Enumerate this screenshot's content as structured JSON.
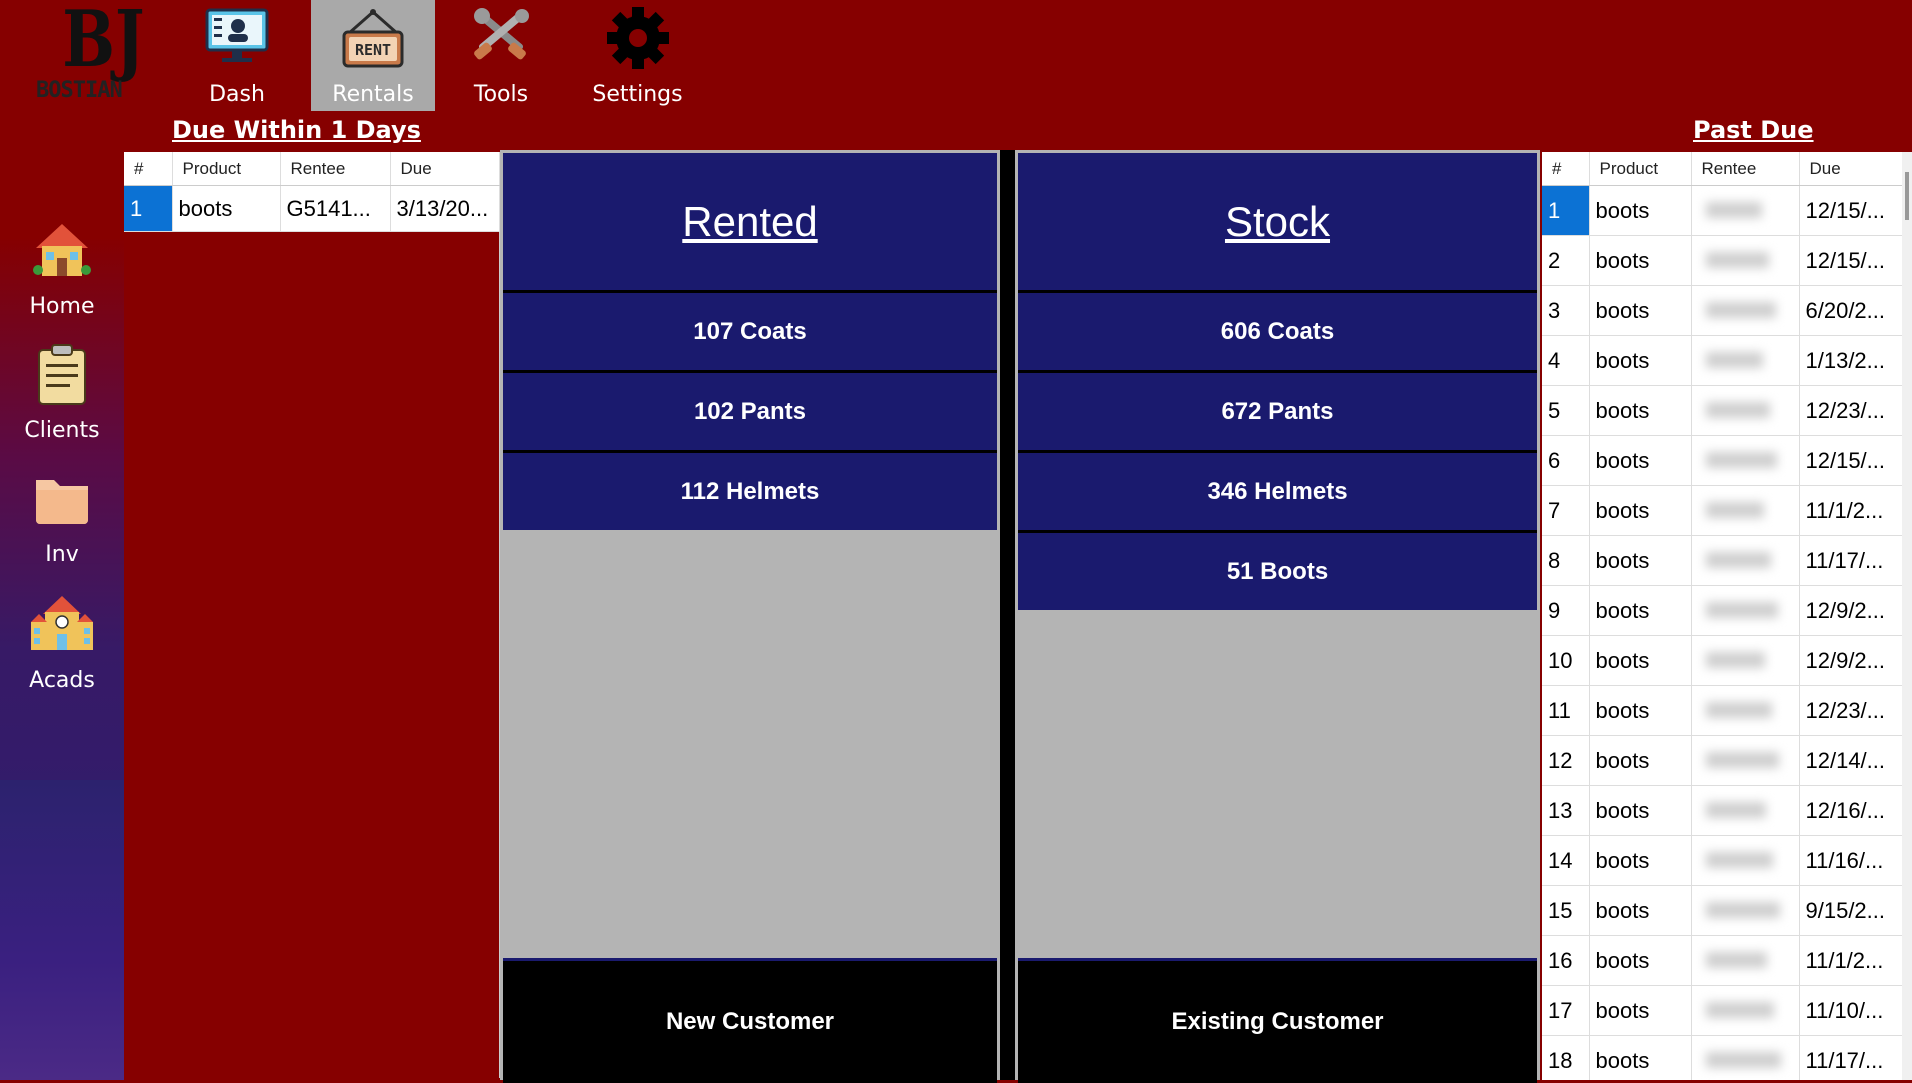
{
  "app": {
    "logo_letters": "BJ",
    "logo_word": "BOSTIAN"
  },
  "nav": [
    {
      "label": "Dash",
      "icon": "monitor-icon",
      "active": false
    },
    {
      "label": "Rentals",
      "icon": "rent-sign-icon",
      "active": true,
      "sign_text": "RENT"
    },
    {
      "label": "Tools",
      "icon": "tools-icon",
      "active": false
    },
    {
      "label": "Settings",
      "icon": "gear-icon",
      "active": false
    }
  ],
  "sidebar": [
    {
      "label": "Home",
      "icon": "house-icon"
    },
    {
      "label": "Clients",
      "icon": "clipboard-icon"
    },
    {
      "label": "Inv",
      "icon": "folder-icon"
    },
    {
      "label": "Acads",
      "icon": "school-icon"
    }
  ],
  "due_soon": {
    "title": "Due Within 1 Days",
    "columns": [
      "#",
      "Product",
      "Rentee",
      "Due"
    ],
    "rows": [
      {
        "n": "1",
        "product": "boots",
        "rentee": "G5141...",
        "due": "3/13/20..."
      }
    ]
  },
  "rented": {
    "title": "Rented",
    "items": [
      "107 Coats",
      "102 Pants",
      "112 Helmets"
    ],
    "action": "New Customer"
  },
  "stock": {
    "title": "Stock",
    "items": [
      "606 Coats",
      "672 Pants",
      "346 Helmets",
      "51 Boots"
    ],
    "action": "Existing Customer"
  },
  "past_due": {
    "title": "Past Due",
    "columns": [
      "#",
      "Product",
      "Rentee",
      "Due"
    ],
    "rows": [
      {
        "n": "1",
        "product": "boots",
        "rentee": "",
        "due": "12/15/..."
      },
      {
        "n": "2",
        "product": "boots",
        "rentee": "",
        "due": "12/15/..."
      },
      {
        "n": "3",
        "product": "boots",
        "rentee": "",
        "due": "6/20/2..."
      },
      {
        "n": "4",
        "product": "boots",
        "rentee": "",
        "due": "1/13/2..."
      },
      {
        "n": "5",
        "product": "boots",
        "rentee": "",
        "due": "12/23/..."
      },
      {
        "n": "6",
        "product": "boots",
        "rentee": "",
        "due": "12/15/..."
      },
      {
        "n": "7",
        "product": "boots",
        "rentee": "",
        "due": "11/1/2..."
      },
      {
        "n": "8",
        "product": "boots",
        "rentee": "",
        "due": "11/17/..."
      },
      {
        "n": "9",
        "product": "boots",
        "rentee": "",
        "due": "12/9/2..."
      },
      {
        "n": "10",
        "product": "boots",
        "rentee": "",
        "due": "12/9/2..."
      },
      {
        "n": "11",
        "product": "boots",
        "rentee": "",
        "due": "12/23/..."
      },
      {
        "n": "12",
        "product": "boots",
        "rentee": "",
        "due": "12/14/..."
      },
      {
        "n": "13",
        "product": "boots",
        "rentee": "",
        "due": "12/16/..."
      },
      {
        "n": "14",
        "product": "boots",
        "rentee": "",
        "due": "11/16/..."
      },
      {
        "n": "15",
        "product": "boots",
        "rentee": "",
        "due": "9/15/2..."
      },
      {
        "n": "16",
        "product": "boots",
        "rentee": "",
        "due": "11/1/2..."
      },
      {
        "n": "17",
        "product": "boots",
        "rentee": "",
        "due": "11/10/..."
      },
      {
        "n": "18",
        "product": "boots",
        "rentee": "",
        "due": "11/17/..."
      }
    ]
  }
}
